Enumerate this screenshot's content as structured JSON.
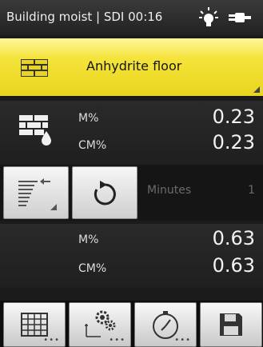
{
  "status": {
    "text": "Building moist | SDI  00:16"
  },
  "material": {
    "name": "Anhydrite floor"
  },
  "reading1": {
    "m_label": "M%",
    "m_value": "0.23",
    "cm_label": "CM%",
    "cm_value": "0.23"
  },
  "timer": {
    "label": "Minutes",
    "value": "1"
  },
  "reading2": {
    "m_label": "M%",
    "m_value": "0.63",
    "cm_label": "CM%",
    "cm_value": "0.63"
  },
  "toolbar": {
    "more_glyph": "•••"
  },
  "icons": [
    "lightbulb-icon",
    "plug-icon",
    "brick-wall-icon",
    "wet-brick-icon",
    "sort-icon",
    "refresh-icon",
    "grid-icon",
    "settings-gears-icon",
    "stopwatch-icon",
    "save-icon"
  ],
  "colors": {
    "accent": "#f2e03a",
    "background": "#1b1b1b"
  }
}
